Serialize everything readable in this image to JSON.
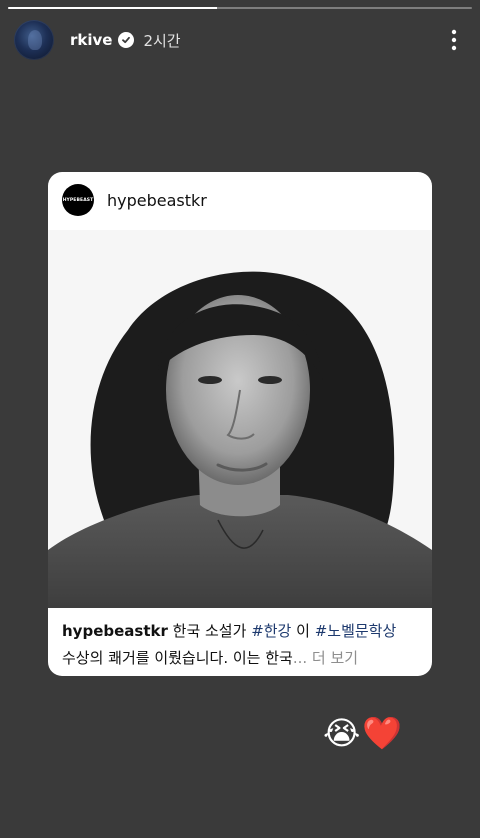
{
  "story": {
    "progress": 0.45,
    "username": "rkive",
    "time": "2시간"
  },
  "post": {
    "username": "hypebeastkr",
    "avatar_text": "HYPEBEAST",
    "caption": {
      "user": "hypebeastkr",
      "text1": " 한국 소설가 ",
      "tag1": "#한강",
      "text2": " 이 ",
      "tag2": "#노벨문학상",
      "text3": "수상의 쾌거를 이뤘습니다. 이는 한국",
      "ellipsis": "...",
      "more": " 더 보기"
    }
  },
  "reactions": {
    "emoji1": "😭",
    "emoji2": "❤️"
  },
  "colors": {
    "background": "#3a3a3a",
    "hashtag": "#1e3a6e",
    "more_link": "#8e8e8e"
  }
}
